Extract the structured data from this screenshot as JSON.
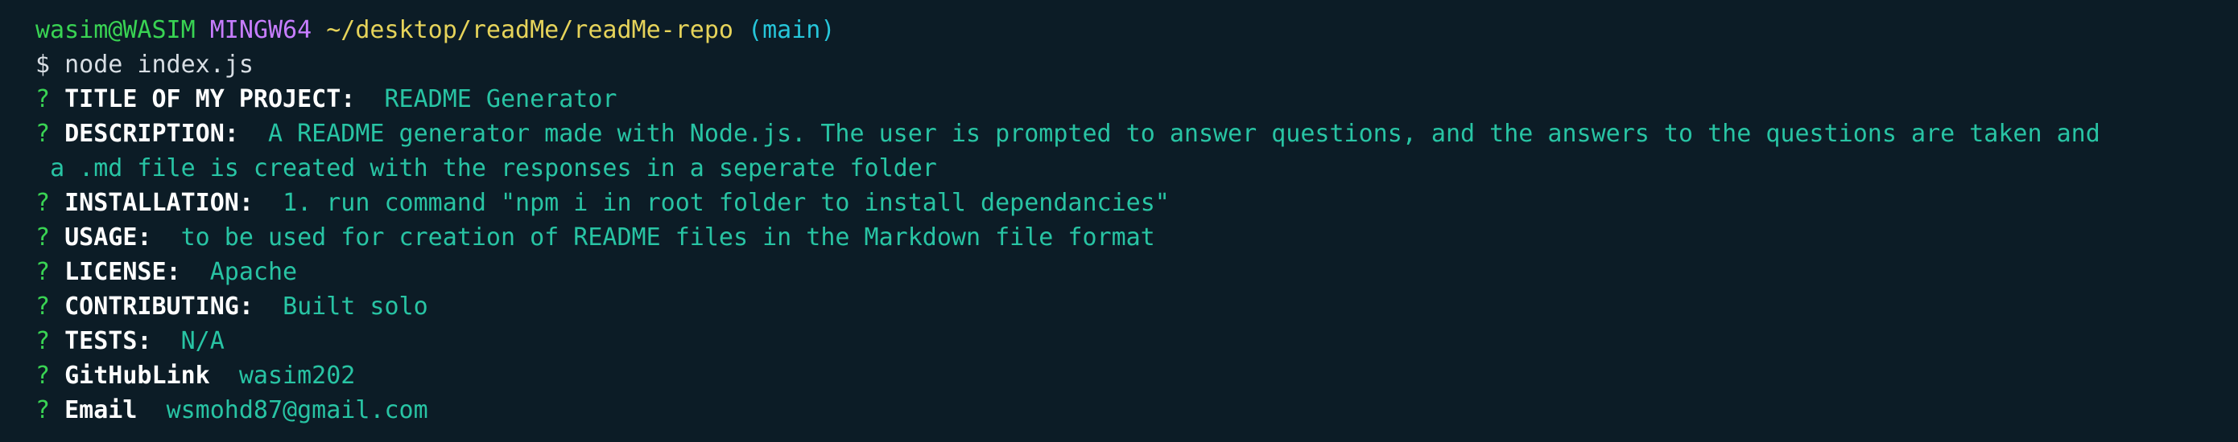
{
  "prompt": {
    "user_host": "wasim@WASIM",
    "system": "MINGW64",
    "path": "~/desktop/readMe/readMe-repo",
    "branch": "(main)"
  },
  "command": {
    "symbol": "$",
    "text": "node index.js"
  },
  "question_mark": "?",
  "answers": [
    {
      "label": "TITLE OF MY PROJECT:",
      "value": "README Generator"
    },
    {
      "label": "DESCRIPTION:",
      "value": "A README generator made with Node.js. The user is prompted to answer questions, and the answers to the questions are taken and",
      "continuation": "a .md file is created with the responses in a seperate folder"
    },
    {
      "label": "INSTALLATION:",
      "value": "1. run command \"npm i in root folder to install dependancies\""
    },
    {
      "label": "USAGE:",
      "value": "to be used for creation of README files in the Markdown file format"
    },
    {
      "label": "LICENSE:",
      "value": "Apache"
    },
    {
      "label": "CONTRIBUTING:",
      "value": "Built solo"
    },
    {
      "label": "TESTS:",
      "value": "N/A"
    },
    {
      "label": "GitHubLink",
      "value": "wasim202"
    },
    {
      "label": "Email",
      "value": "wsmohd87@gmail.com"
    }
  ],
  "colors": {
    "background": "#0c1c26",
    "user": "#39d353",
    "system": "#c77dff",
    "path": "#e6d35a",
    "branch": "#26c6da",
    "answer": "#28c4a4"
  }
}
